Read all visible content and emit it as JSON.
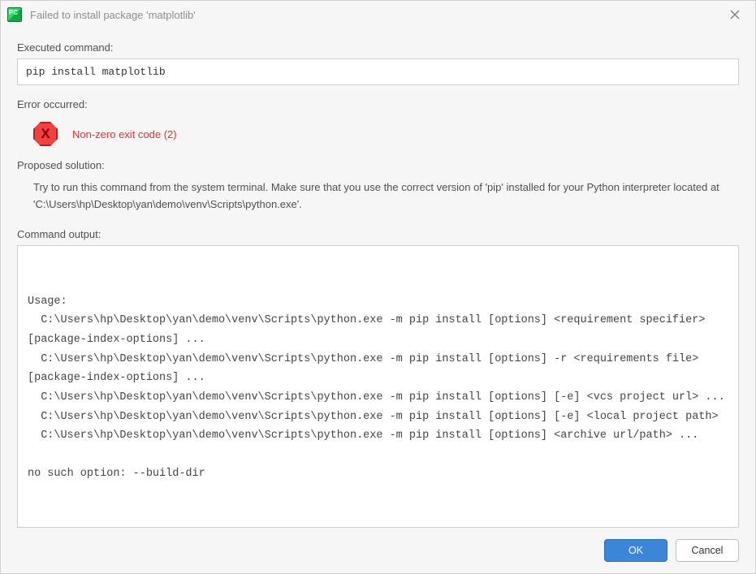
{
  "window": {
    "title": "Failed to install package 'matplotlib'"
  },
  "labels": {
    "executed_command": "Executed command:",
    "error_occurred": "Error occurred:",
    "proposed_solution": "Proposed solution:",
    "command_output": "Command output:"
  },
  "executed_command": "pip install matplotlib",
  "error_message": "Non-zero exit code (2)",
  "proposed_solution": "Try to run this command from the system terminal. Make sure that you use the correct version of 'pip' installed for your Python interpreter located at 'C:\\Users\\hp\\Desktop\\yan\\demo\\venv\\Scripts\\python.exe'.",
  "command_output": "\n\nUsage:\n  C:\\Users\\hp\\Desktop\\yan\\demo\\venv\\Scripts\\python.exe -m pip install [options] <requirement specifier> [package-index-options] ...\n  C:\\Users\\hp\\Desktop\\yan\\demo\\venv\\Scripts\\python.exe -m pip install [options] -r <requirements file> [package-index-options] ...\n  C:\\Users\\hp\\Desktop\\yan\\demo\\venv\\Scripts\\python.exe -m pip install [options] [-e] <vcs project url> ...\n  C:\\Users\\hp\\Desktop\\yan\\demo\\venv\\Scripts\\python.exe -m pip install [options] [-e] <local project path>\n  C:\\Users\\hp\\Desktop\\yan\\demo\\venv\\Scripts\\python.exe -m pip install [options] <archive url/path> ...\n\nno such option: --build-dir",
  "buttons": {
    "ok": "OK",
    "cancel": "Cancel"
  }
}
